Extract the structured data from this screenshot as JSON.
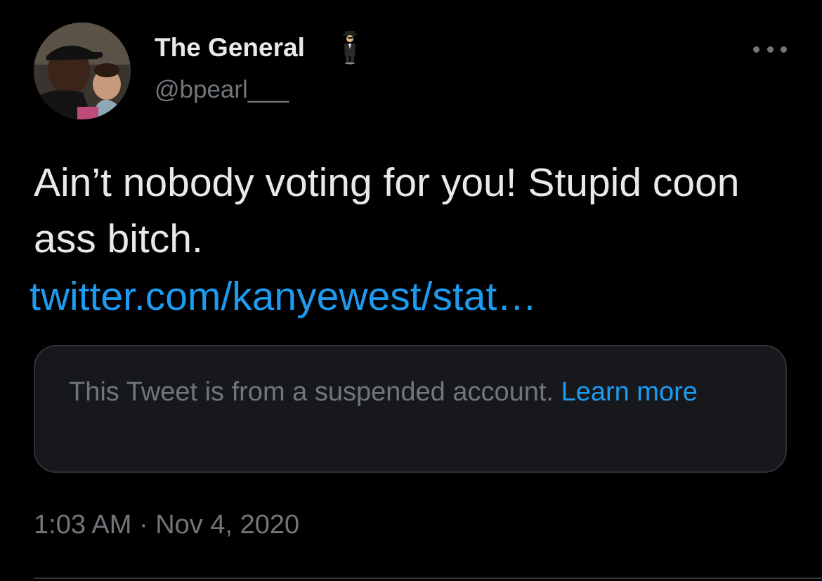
{
  "author": {
    "display_name": "The General",
    "name_emoji": "man-in-business-suit-levitating-emoji",
    "handle": "@bpearl___",
    "avatar": "profile-photo"
  },
  "menu": {
    "more_icon": "ellipsis-icon"
  },
  "tweet": {
    "text": "Ain’t nobody voting for you! Stupid coon ass bitch.",
    "link_text": "twitter.com/kanyewest/stat…"
  },
  "quoted_card": {
    "message": "This Tweet is from a suspended account.",
    "learn_more": "Learn more"
  },
  "meta": {
    "timestamp": "1:03 AM · Nov 4, 2020"
  },
  "colors": {
    "background": "#000000",
    "primary_text": "#e7e9ea",
    "secondary_text": "#71767b",
    "link": "#1d9bf0",
    "card_background": "#16181c",
    "border": "#2f3336"
  }
}
